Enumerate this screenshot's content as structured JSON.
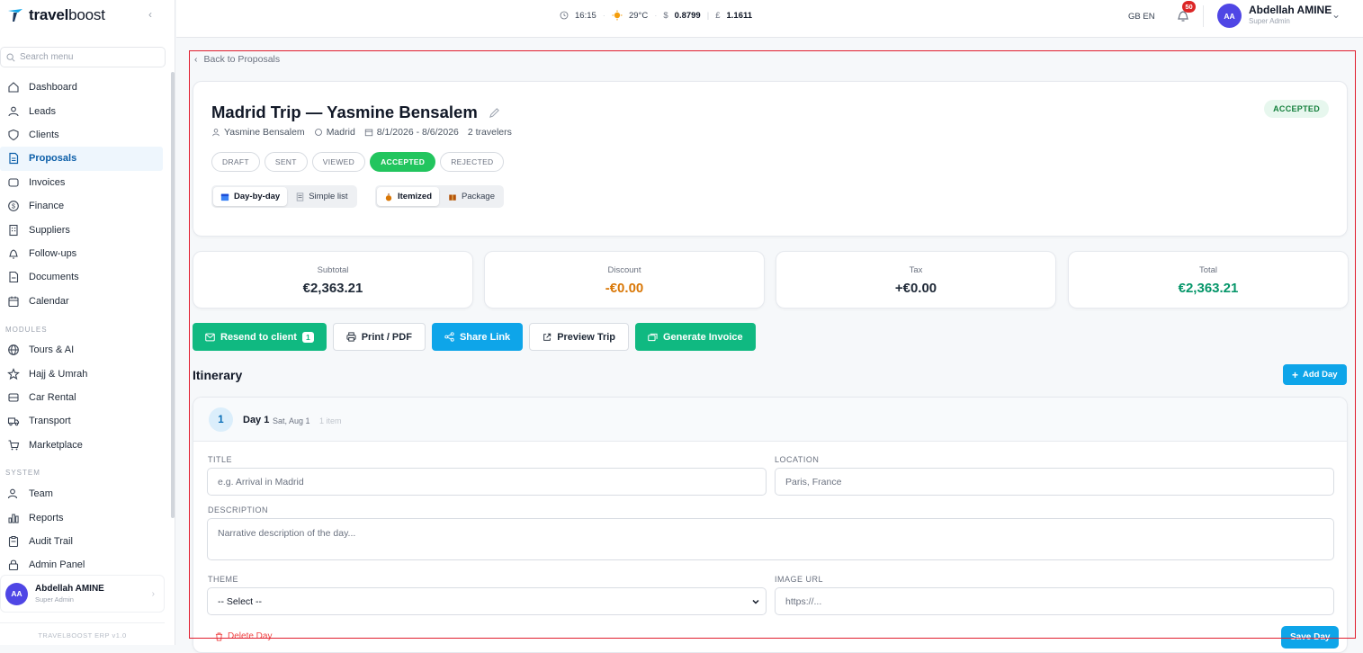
{
  "brand": {
    "name_a": "travel",
    "name_b": "boost"
  },
  "sidebar": {
    "search_placeholder": "Search menu",
    "items": [
      {
        "label": "Dashboard"
      },
      {
        "label": "Leads"
      },
      {
        "label": "Clients"
      },
      {
        "label": "Proposals"
      },
      {
        "label": "Invoices"
      },
      {
        "label": "Finance"
      },
      {
        "label": "Suppliers"
      },
      {
        "label": "Follow-ups"
      },
      {
        "label": "Documents"
      },
      {
        "label": "Calendar"
      }
    ],
    "modules_label": "MODULES",
    "modules": [
      {
        "label": "Tours & AI"
      },
      {
        "label": "Hajj & Umrah"
      },
      {
        "label": "Car Rental"
      },
      {
        "label": "Transport"
      },
      {
        "label": "Marketplace"
      }
    ],
    "system_label": "SYSTEM",
    "system": [
      {
        "label": "Team"
      },
      {
        "label": "Reports"
      },
      {
        "label": "Audit Trail"
      },
      {
        "label": "Admin Panel"
      }
    ],
    "user": {
      "initials": "AA",
      "name": "Abdellah AMINE",
      "role": "Super Admin"
    },
    "version": "TRAVELBOOST ERP v1.0"
  },
  "topbar": {
    "time": "16:15",
    "temp": "29°C",
    "usd_symbol": "$",
    "usd": "0.8799",
    "gbp_symbol": "£",
    "gbp": "1.1611",
    "lang_flag": "GB",
    "lang": "EN",
    "notifications": "50",
    "user": {
      "initials": "AA",
      "name": "Abdellah AMINE",
      "role": "Super Admin"
    }
  },
  "back_link": "Back to Proposals",
  "proposal": {
    "title": "Madrid Trip — Yasmine Bensalem",
    "client": "Yasmine Bensalem",
    "location": "Madrid",
    "dates": "8/1/2026 - 8/6/2026",
    "travelers": "2 travelers",
    "status": "ACCEPTED",
    "stages": [
      "DRAFT",
      "SENT",
      "VIEWED",
      "ACCEPTED",
      "REJECTED"
    ],
    "view_modes": [
      "Day-by-day",
      "Simple list"
    ],
    "pricing_modes": [
      "Itemized",
      "Package"
    ]
  },
  "summary": [
    {
      "label": "Subtotal",
      "value": "€2,363.21",
      "color": "#1f2937"
    },
    {
      "label": "Discount",
      "value": "-€0.00",
      "color": "#d97706"
    },
    {
      "label": "Tax",
      "value": "+€0.00",
      "color": "#1f2937"
    },
    {
      "label": "Total",
      "value": "€2,363.21",
      "color": "#059669"
    }
  ],
  "actions": {
    "resend": "Resend to client",
    "resend_count": "1",
    "print": "Print / PDF",
    "share": "Share Link",
    "preview": "Preview Trip",
    "invoice": "Generate Invoice"
  },
  "itinerary": {
    "title": "Itinerary",
    "add_day": "Add Day",
    "day": {
      "number": "1",
      "label": "Day 1",
      "date": "Sat, Aug 1",
      "items": "1 item",
      "title_label": "TITLE",
      "title_placeholder": "e.g. Arrival in Madrid",
      "location_label": "LOCATION",
      "location_placeholder": "Paris, France",
      "description_label": "DESCRIPTION",
      "description_placeholder": "Narrative description of the day...",
      "theme_label": "THEME",
      "theme_value": "-- Select --",
      "image_label": "IMAGE URL",
      "image_placeholder": "https://...",
      "delete": "Delete Day",
      "save": "Save Day"
    }
  },
  "colors": {
    "accent": "#0ea5e9",
    "green": "#10b981",
    "frame": "#e11d2e"
  }
}
